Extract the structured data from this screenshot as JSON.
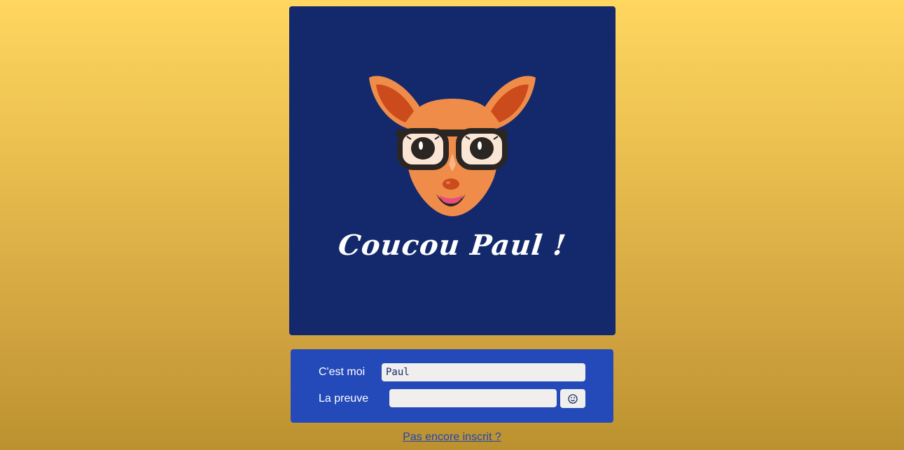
{
  "greeting": "Coucou Paul !",
  "login": {
    "username_label": "C'est moi",
    "username_value": "Paul",
    "password_label": "La preuve",
    "password_value": "",
    "reveal_icon": "face-wink-icon"
  },
  "signup_link": "Pas encore inscrit ?",
  "colors": {
    "card_bg": "#14296c",
    "panel_bg": "#2449b9",
    "deer_orange": "#f08c4a",
    "ear_inner": "#cc4b1c",
    "link": "#2145b4"
  }
}
